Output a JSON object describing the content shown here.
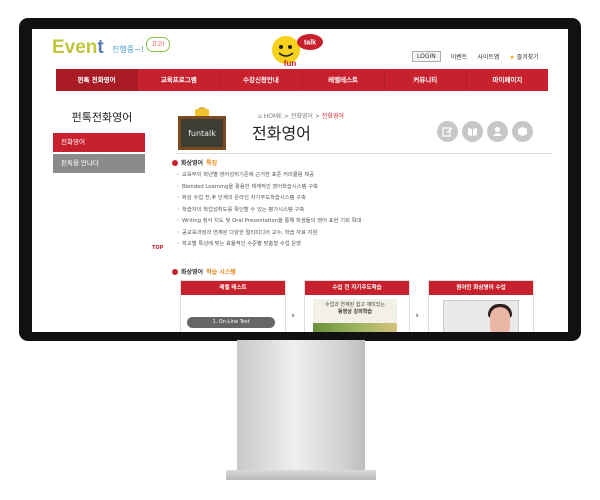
{
  "header": {
    "logo_event_part1": "Even",
    "logo_event_part2": "t",
    "logo_event_sub": "진행중~!",
    "logo_bubble": "고고!",
    "brand_top": "talk",
    "brand_bottom": "fun",
    "login": "LOGIN",
    "event": "이벤트",
    "sitemap": "사이트맵",
    "favorites": "즐겨찾기"
  },
  "nav": {
    "items": [
      {
        "label": "펀톡 전화영어"
      },
      {
        "label": "교육프로그램"
      },
      {
        "label": "수강신청안내"
      },
      {
        "label": "레벨테스트"
      },
      {
        "label": "커뮤니티"
      },
      {
        "label": "마이페이지"
      }
    ]
  },
  "sidebar": {
    "title": "펀톡전화영어",
    "items": [
      {
        "label": "전화영어",
        "active": true
      },
      {
        "label": "펀톡을 만나다",
        "active": false
      }
    ],
    "top_tag": "TOP"
  },
  "content": {
    "chalk_label": "funtalk",
    "breadcrumb": {
      "home": "HOME",
      "sep": ">",
      "parent": "전화영어",
      "current": "전화영어"
    },
    "title": "전화영어",
    "section1": {
      "label": "화상영어",
      "highlight": "특징"
    },
    "features": [
      "교육부의 학년별 영어성취기준에 근거한 표준 커리큘럼 제공",
      "Blended Learning을 활용한 체계적인 영어학습시스템 구축",
      "화상 수업 전,후 단계의 온라인 자기주도학습시스템 구축",
      "학습자의 학업성취도를 확인할 수 있는 평가시스템 구축",
      "Writing 첨삭 지도 및 Oral Presentation을 통해 학생들의 영어 표현 기회 확대",
      "공교육과정과 연계된 다양한 멀티미디어 교수, 학습 자료 지원",
      "학교별 특성에 맞는 효율적인 수준별 맞춤형 수업 운영"
    ],
    "section2": {
      "label": "화상영어",
      "highlight": "학습 시스템"
    },
    "cards": [
      {
        "title": "레벨 테스트",
        "pill": "1. On-Line Test"
      },
      {
        "title": "수업 전 자기주도학습",
        "img_line1": "수업과 연계된 쉽고 재미있는",
        "img_line2": "동영상 강의학습"
      },
      {
        "title": "원어민 화상영어 수업"
      }
    ]
  },
  "colors": {
    "brand_red": "#c8212e",
    "accent_orange": "#e8891e",
    "gray_menu": "#8b8b8b"
  }
}
